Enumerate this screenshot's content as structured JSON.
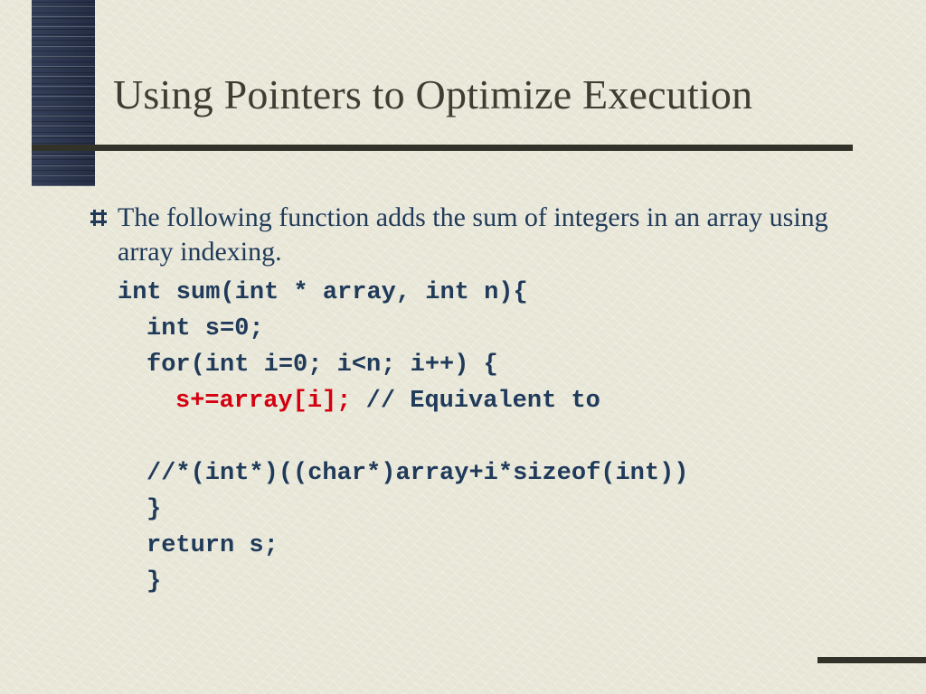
{
  "title": "Using Pointers to Optimize Execution",
  "bullet": "The following function adds the sum of integers in an array using array indexing.",
  "code": {
    "l1": "int sum(int * array, int n){",
    "l2": "int s=0;",
    "l3": "for(int i=0; i<n; i++) {",
    "l4_red": "s+=array[i];",
    "l4_rest": " // Equivalent to",
    "l5": "//*(int*)((char*)array+i*sizeof(int))",
    "l6": "}",
    "l7": "return s;",
    "l8": "}"
  },
  "colors": {
    "text": "#203a5a",
    "highlight": "#d4000f",
    "rule": "#323228",
    "bg": "#e8e7d8"
  }
}
